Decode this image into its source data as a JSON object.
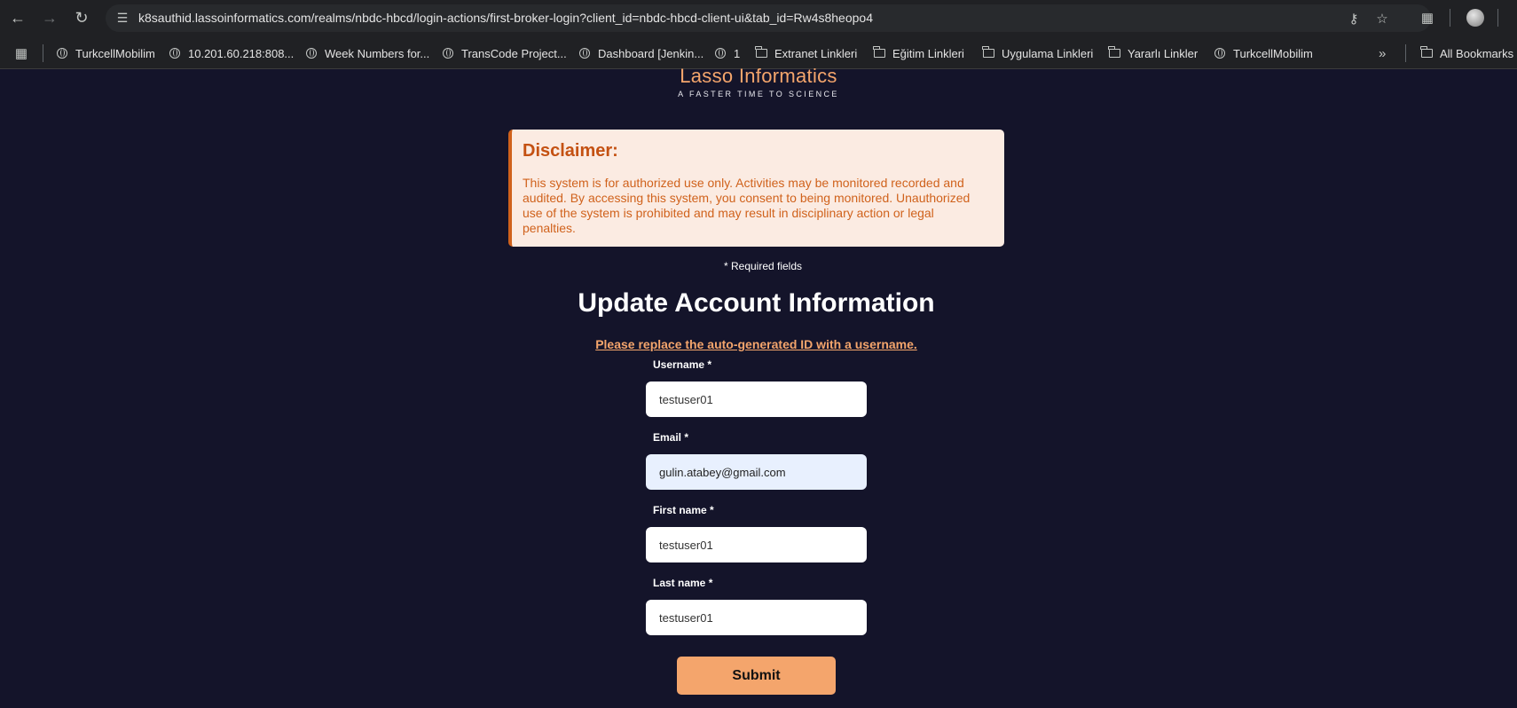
{
  "browser": {
    "url": "k8sauthid.lassoinformatics.com/realms/nbdc-hbcd/login-actions/first-broker-login?client_id=nbdc-hbcd-client-ui&tab_id=Rw4s8heopo4",
    "icons": {
      "back": "arrow-left-icon",
      "forward": "arrow-right-icon",
      "reload": "reload-icon",
      "site_info": "tune-icon",
      "password": "key-icon",
      "bookmark_star": "star-icon",
      "extensions": "puzzle-icon",
      "profile": "avatar-icon"
    },
    "bookmarks": [
      {
        "label": "TurkcellMobilim",
        "icon": "globe-icon"
      },
      {
        "label": "10.201.60.218:808...",
        "icon": "globe-icon"
      },
      {
        "label": "Week Numbers for...",
        "icon": "globe-icon"
      },
      {
        "label": "TransCode Project...",
        "icon": "globe-icon"
      },
      {
        "label": "Dashboard [Jenkin...",
        "icon": "globe-icon"
      },
      {
        "label": "1",
        "icon": "globe-icon"
      },
      {
        "label": "Extranet Linkleri",
        "icon": "folder-icon"
      },
      {
        "label": "Eğitim Linkleri",
        "icon": "folder-icon"
      },
      {
        "label": "Uygulama Linkleri",
        "icon": "folder-icon"
      },
      {
        "label": "Yararlı Linkler",
        "icon": "folder-icon"
      },
      {
        "label": "TurkcellMobilim",
        "icon": "globe-icon"
      }
    ],
    "all_bookmarks": "All Bookmarks"
  },
  "brand": {
    "name": "Lasso Informatics",
    "tagline": "A FASTER TIME TO SCIENCE",
    "accent": "#f4a56c"
  },
  "disclaimer": {
    "title": "Disclaimer:",
    "text": "This system is for authorized use only. Activities may be monitored recorded and audited. By accessing this system, you consent to being monitored. Unauthorized use of the system is prohibited and may result in disciplinary action or legal penalties."
  },
  "form": {
    "required_note": "* Required fields",
    "title": "Update Account Information",
    "hint": "Please replace the auto-generated ID with a username.",
    "fields": {
      "username": {
        "label": "Username *",
        "value": "testuser01"
      },
      "email": {
        "label": "Email *",
        "value": "gulin.atabey@gmail.com"
      },
      "first_name": {
        "label": "First name *",
        "value": "testuser01"
      },
      "last_name": {
        "label": "Last name *",
        "value": "testuser01"
      }
    },
    "submit_label": "Submit"
  }
}
